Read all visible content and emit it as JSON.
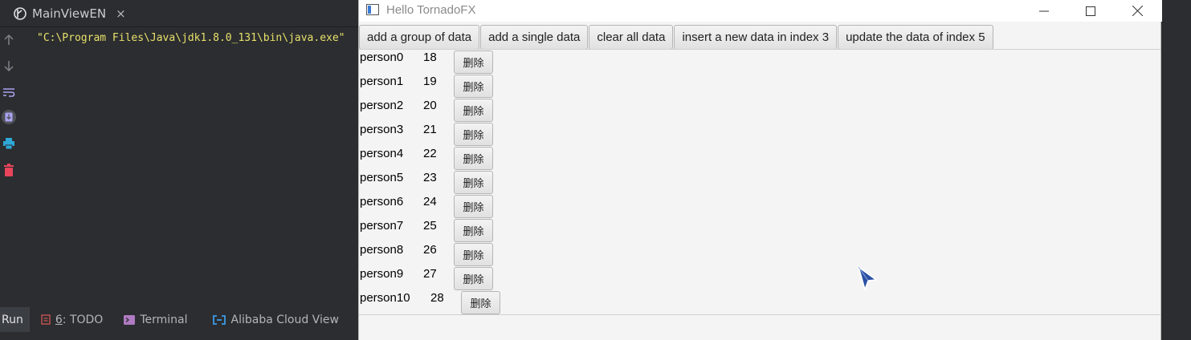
{
  "ide": {
    "tab_title": "MainViewEN",
    "tab_close": "×",
    "console_line": "\"C:\\Program Files\\Java\\jdk1.8.0_131\\bin\\java.exe\"",
    "gutter_icons": [
      "arrow-up-icon",
      "arrow-down-icon",
      "soft-wrap-icon",
      "scroll-to-end-icon",
      "print-icon",
      "trash-icon"
    ],
    "bottom_tabs": {
      "run": "Run",
      "todo_num": "6",
      "todo_label": ": TODO",
      "terminal": "Terminal",
      "cloud": "Alibaba Cloud View"
    }
  },
  "window": {
    "title": "Hello TornadoFX",
    "controls": {
      "minimize": "—",
      "maximize": "☐",
      "close": "✕"
    },
    "toolbar": {
      "add_group": "add a group of data",
      "add_single": "add a single data",
      "clear_all": "clear all data",
      "insert": "insert a new data in index 3",
      "update": "update the data of index 5"
    },
    "delete_label": "删除",
    "persons": [
      {
        "name": "person0",
        "age": "18"
      },
      {
        "name": "person1",
        "age": "19"
      },
      {
        "name": "person2",
        "age": "20"
      },
      {
        "name": "person3",
        "age": "21"
      },
      {
        "name": "person4",
        "age": "22"
      },
      {
        "name": "person5",
        "age": "23"
      },
      {
        "name": "person6",
        "age": "24"
      },
      {
        "name": "person7",
        "age": "25"
      },
      {
        "name": "person8",
        "age": "26"
      },
      {
        "name": "person9",
        "age": "27"
      },
      {
        "name": "person10",
        "age": "28"
      }
    ]
  },
  "colors": {
    "ide_bg": "#2b2d30",
    "console_text": "#e8e06a",
    "scroll_icon": "#a9a3f0",
    "print_icon": "#2fa8d8",
    "trash_icon": "#e8455b",
    "cursor": "#2b4fa3"
  }
}
